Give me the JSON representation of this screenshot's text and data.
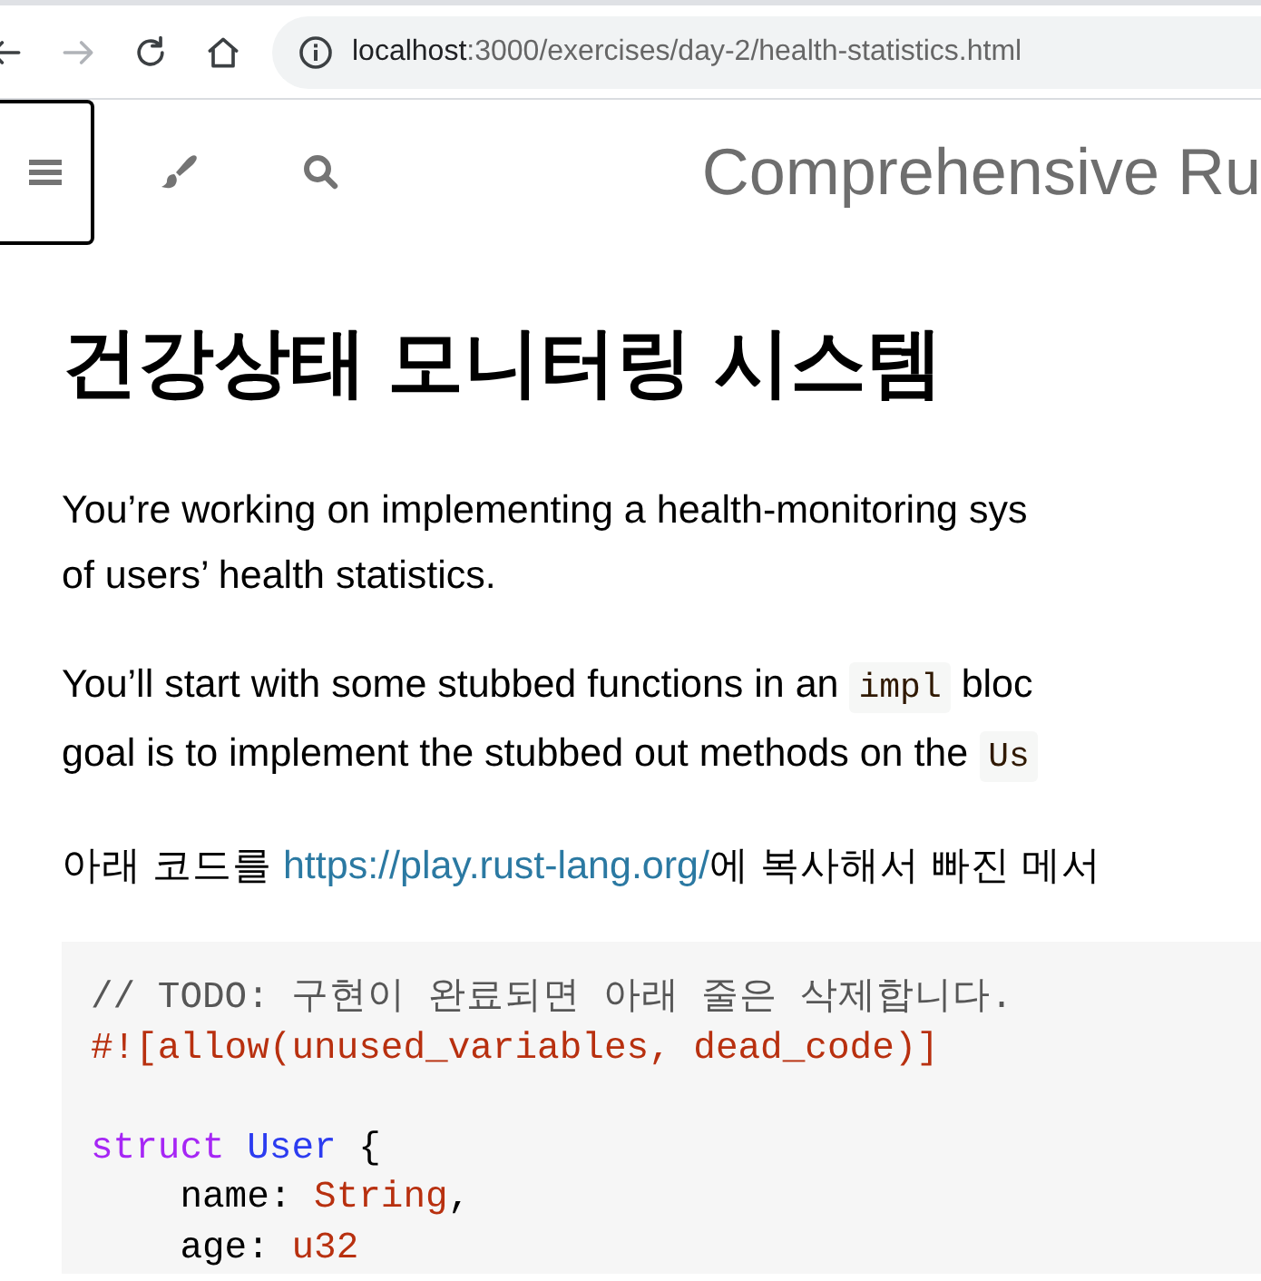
{
  "browser": {
    "nav_buttons": [
      {
        "kind": "back",
        "disabled": false
      },
      {
        "kind": "forward",
        "disabled": true
      },
      {
        "kind": "reload",
        "disabled": false
      },
      {
        "kind": "home",
        "disabled": false
      }
    ],
    "url": {
      "host": "localhost",
      "path": ":3000/exercises/day-2/health-statistics.html"
    }
  },
  "menu_bar": {
    "buttons": [
      {
        "kind": "menu",
        "focused": true
      },
      {
        "kind": "theme",
        "focused": false
      },
      {
        "kind": "search",
        "focused": false
      }
    ],
    "title": "Comprehensive Ru"
  },
  "content": {
    "heading": "건강상태 모니터링 시스템",
    "paragraphs": [
      {
        "lines": [
          [
            {
              "kind": "text",
              "text": "You’re working on implementing a health-monitoring sys"
            }
          ],
          [
            {
              "kind": "text",
              "text": "of users’ health statistics."
            }
          ]
        ]
      },
      {
        "lines": [
          [
            {
              "kind": "text",
              "text": "You’ll start with some stubbed functions in an "
            },
            {
              "kind": "code",
              "text": "impl"
            },
            {
              "kind": "text",
              "text": " bloc"
            }
          ],
          [
            {
              "kind": "text",
              "text": "goal is to implement the stubbed out methods on the "
            },
            {
              "kind": "code",
              "text": "Us"
            }
          ]
        ]
      },
      {
        "lines": [
          [
            {
              "kind": "text",
              "text": "아래 코드를 "
            },
            {
              "kind": "link",
              "text": "https://play.rust-lang.org/"
            },
            {
              "kind": "text",
              "text": "에 복사해서 빠진 메서"
            }
          ]
        ]
      }
    ],
    "code_block": {
      "lines": [
        {
          "blank_before": false,
          "tokens": [
            {
              "kind": "comment",
              "text": "// TODO: 구현이 완료되면 아래 줄은 삭제합니다."
            }
          ]
        },
        {
          "blank_before": false,
          "tokens": [
            {
              "kind": "meta",
              "text": "#![allow(unused_variables, dead_code)]"
            }
          ]
        },
        {
          "blank_before": true,
          "tokens": [
            {
              "kind": "keyword",
              "text": "struct "
            },
            {
              "kind": "title",
              "text": "User"
            },
            {
              "kind": "plain",
              "text": " {"
            }
          ]
        },
        {
          "blank_before": false,
          "tokens": [
            {
              "kind": "plain",
              "text": "    name: "
            },
            {
              "kind": "type",
              "text": "String"
            },
            {
              "kind": "plain",
              "text": ","
            }
          ]
        },
        {
          "blank_before": false,
          "tokens": [
            {
              "kind": "plain",
              "text": "    age: "
            },
            {
              "kind": "type",
              "text": "u32"
            }
          ]
        }
      ]
    }
  }
}
